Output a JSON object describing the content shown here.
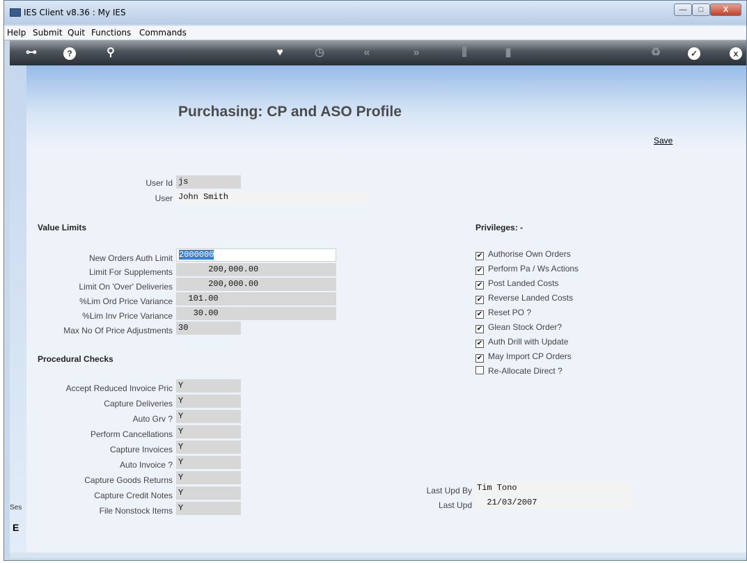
{
  "window": {
    "title": "IES Client v8.36 : My IES",
    "min_label": "—",
    "max_label": "□",
    "close_label": "X"
  },
  "menu": [
    "Help",
    "Submit",
    "Quit",
    "Functions",
    "Commands"
  ],
  "toolbar": {
    "key": "⊶",
    "help": "?",
    "search": "⚲",
    "favourite": "♥",
    "history": "◷",
    "prev": "«",
    "next": "»",
    "tools": "⫼",
    "doc": "▮",
    "refresh": "♻",
    "ok": "✓",
    "close": "x"
  },
  "page": {
    "title": "Purchasing: CP and ASO Profile",
    "save": "Save"
  },
  "user": {
    "userid_label": "User Id",
    "userid": "js",
    "user_label": "User",
    "user": "John Smith"
  },
  "value_limits": {
    "heading": "Value Limits",
    "fields": [
      {
        "label": "New Orders Auth Limit",
        "value": "2000000"
      },
      {
        "label": "Limit For Supplements",
        "value": "      200,000.00"
      },
      {
        "label": "Limit On 'Over' Deliveries",
        "value": "      200,000.00"
      },
      {
        "label": "%Lim Ord Price Variance",
        "value": "  101.00"
      },
      {
        "label": "%Lim Inv Price Variance",
        "value": "   30.00"
      },
      {
        "label": "Max No Of Price Adjustments",
        "value": "30"
      }
    ]
  },
  "procedural_checks": {
    "heading": "Procedural Checks",
    "fields": [
      {
        "label": "Accept Reduced Invoice Pric",
        "value": "Y"
      },
      {
        "label": "Capture Deliveries",
        "value": "Y"
      },
      {
        "label": "Auto Grv ?",
        "value": "Y"
      },
      {
        "label": "Perform Cancellations",
        "value": "Y"
      },
      {
        "label": "Capture Invoices",
        "value": "Y"
      },
      {
        "label": "Auto Invoice ?",
        "value": "Y"
      },
      {
        "label": "Capture Goods Returns",
        "value": "Y"
      },
      {
        "label": "Capture Credit Notes",
        "value": "Y"
      },
      {
        "label": "File Nonstock Items",
        "value": "Y"
      }
    ]
  },
  "privileges": {
    "heading": "Privileges: -",
    "items": [
      {
        "label": "Authorise Own Orders",
        "checked": true,
        "mark": "✔"
      },
      {
        "label": "Perform Pa / Ws Actions",
        "checked": true,
        "mark": "✔"
      },
      {
        "label": "Post Landed Costs",
        "checked": true,
        "mark": "✔"
      },
      {
        "label": "Reverse Landed Costs",
        "checked": true,
        "mark": "✔"
      },
      {
        "label": "Reset PO ?",
        "checked": true,
        "mark": "✔"
      },
      {
        "label": "Glean Stock Order?",
        "checked": true,
        "mark": "✔"
      },
      {
        "label": "Auth Drill with Update",
        "checked": true,
        "mark": "✔"
      },
      {
        "label": "May Import CP Orders",
        "checked": true,
        "mark": "✔"
      },
      {
        "label": "Re-Allocate Direct ?",
        "checked": false,
        "mark": ""
      }
    ]
  },
  "audit": {
    "last_upd_by_label": "Last Upd By",
    "last_upd_by": "Tim Tono",
    "last_upd_label": "Last Upd",
    "last_upd": "  21/03/2007"
  },
  "session": {
    "label": "Ses",
    "glyph": "E"
  }
}
